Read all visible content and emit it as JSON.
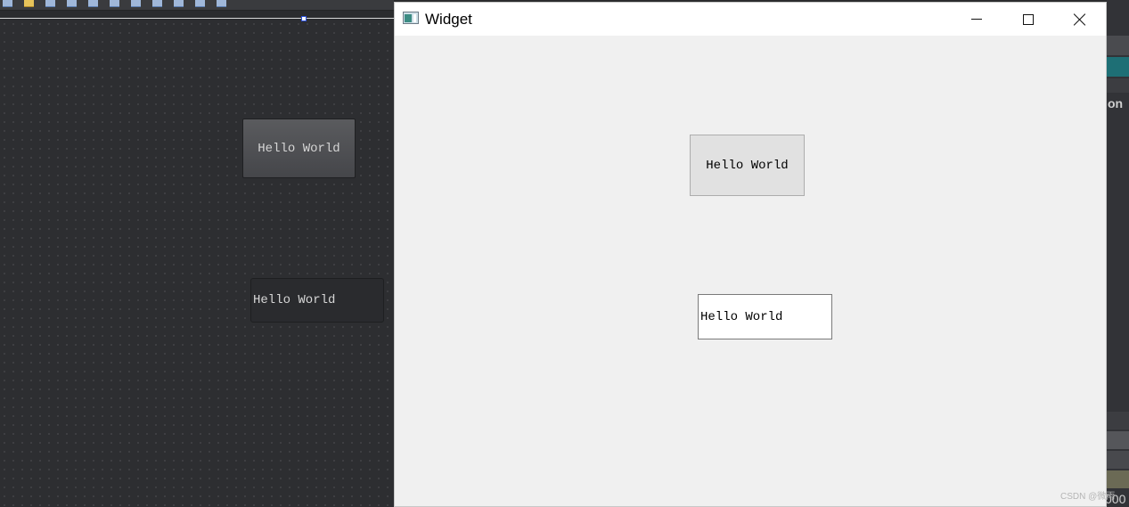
{
  "designer": {
    "button_label": "Hello World",
    "line_edit_value": "Hello World"
  },
  "window": {
    "title": "Widget",
    "button_label": "Hello World",
    "line_edit_value": "Hello World"
  },
  "right_panel": {
    "partial_label": "on",
    "partial_value": "000"
  },
  "watermark": "CSDN @微雨",
  "colors": {
    "designer_background": "#2d2e31",
    "window_background": "#f0f0f0",
    "panel_accent": "#1e6f75"
  }
}
